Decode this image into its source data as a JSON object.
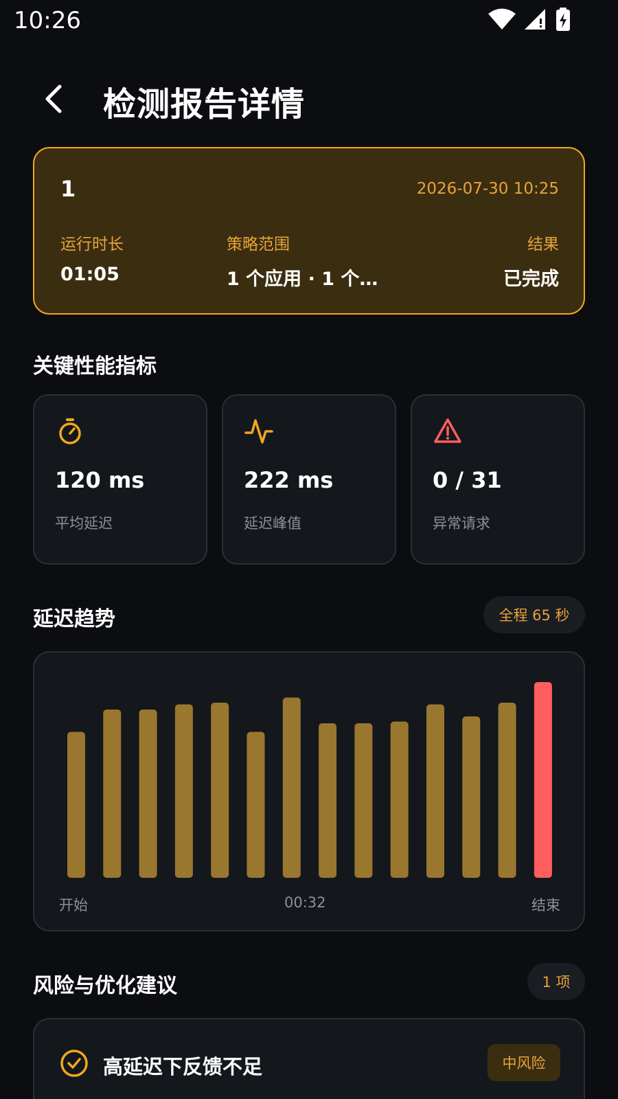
{
  "status_bar": {
    "time": "10:26"
  },
  "header": {
    "title": "检测报告详情"
  },
  "summary": {
    "id": "1",
    "datetime": "2026-07-30 10:25",
    "duration_label": "运行时长",
    "duration_value": "01:05",
    "scope_label": "策略范围",
    "scope_value": "1 个应用 · 1 个…",
    "result_label": "结果",
    "result_value": "已完成"
  },
  "metrics_section": {
    "title": "关键性能指标",
    "items": [
      {
        "value": "120 ms",
        "label": "平均延迟",
        "icon": "stopwatch-icon"
      },
      {
        "value": "222 ms",
        "label": "延迟峰值",
        "icon": "pulse-icon"
      },
      {
        "value": "0 / 31",
        "label": "异常请求",
        "icon": "warning-icon"
      }
    ]
  },
  "trend_section": {
    "title": "延迟趋势",
    "badge": "全程 65 秒"
  },
  "chart_data": {
    "type": "bar",
    "values": [
      85,
      98,
      98,
      101,
      102,
      85,
      105,
      90,
      90,
      91,
      101,
      94,
      102,
      114
    ],
    "highlight_index": 13,
    "x_tick_labels": [
      "开始",
      "00:32",
      "结束"
    ],
    "ylim": [
      0,
      120
    ],
    "grid": false,
    "colors": {
      "normal": "#9a772f",
      "peak": "#ff5e5e"
    }
  },
  "risk_section": {
    "title": "风险与优化建议",
    "count_badge": "1 项",
    "items": [
      {
        "title": "高延迟下反馈不足",
        "level": "中风险"
      }
    ]
  },
  "colors": {
    "accent": "#f0a820",
    "background": "#0b0d11",
    "card": "#14171c",
    "danger": "#ff5e5e"
  }
}
